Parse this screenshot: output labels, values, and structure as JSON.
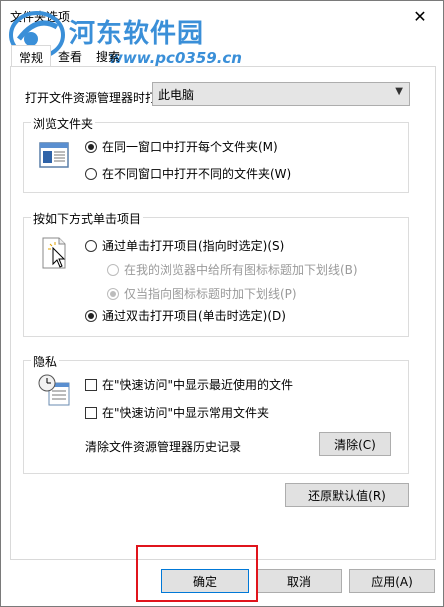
{
  "window": {
    "title": "文件夹选项",
    "close_glyph": "✕"
  },
  "watermark": {
    "text": "河东软件园",
    "url": "www.pc0359.cn"
  },
  "tabs": [
    {
      "label": "常规",
      "active": true
    },
    {
      "label": "查看",
      "active": false
    },
    {
      "label": "搜索",
      "active": false
    }
  ],
  "open_explorer": {
    "label": "打开文件资源管理器时打",
    "value": "此电脑"
  },
  "browse": {
    "title": "浏览文件夹",
    "icon": "folder-window-icon",
    "options": [
      {
        "label": "在同一窗口中打开每个文件夹(M)",
        "checked": true
      },
      {
        "label": "在不同窗口中打开不同的文件夹(W)",
        "checked": false
      }
    ]
  },
  "click": {
    "title": "按如下方式单击项目",
    "icon": "pointer-click-icon",
    "single": {
      "label": "通过单击打开项目(指向时选定)(S)",
      "checked": false
    },
    "sub": [
      {
        "label": "在我的浏览器中给所有图标标题加下划线(B)",
        "checked": false
      },
      {
        "label": "仅当指向图标标题时加下划线(P)",
        "checked": true
      }
    ],
    "double": {
      "label": "通过双击打开项目(单击时选定)(D)",
      "checked": true
    }
  },
  "privacy": {
    "title": "隐私",
    "icon": "clock-document-icon",
    "checks": [
      {
        "label": "在\"快速访问\"中显示最近使用的文件",
        "checked": false
      },
      {
        "label": "在\"快速访问\"中显示常用文件夹",
        "checked": false
      }
    ],
    "clear_label": "清除文件资源管理器历史记录",
    "clear_button": "清除(C)"
  },
  "restore_button": "还原默认值(R)",
  "footer": {
    "ok": "确定",
    "cancel": "取消",
    "apply": "应用(A)"
  },
  "colors": {
    "highlight": "#e0141c",
    "watermark": "#3a8fd8",
    "accent_border": "#0078d7"
  }
}
